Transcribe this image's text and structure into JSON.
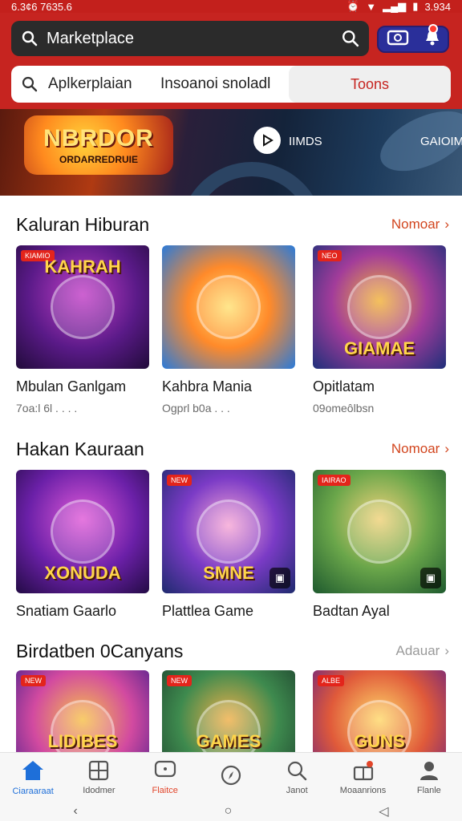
{
  "status": {
    "left": "6.3¢6 7635.6",
    "right": "3.934"
  },
  "search": {
    "label": "Marketplace"
  },
  "filters": {
    "first": "Aplkerplaian",
    "second": "Insoanoi snoladl",
    "segment": "Toons"
  },
  "banner": {
    "logo_line1": "NBRDOR",
    "logo_line2": "ORDARREDRUIE",
    "text1": "IIMDS",
    "text2": "GAIOIM"
  },
  "sections": [
    {
      "title": "Kaluran Hiburan",
      "link": "Nomoar",
      "cards": [
        {
          "title": "Mbulan Ganlgam",
          "sub": "7oa:l 6l . . . .",
          "tag": "KIAMIO",
          "caption": "KAHRAH"
        },
        {
          "title": "Kahbra Mania",
          "sub": "Ogprl b0a . . .",
          "tag": "",
          "caption": ""
        },
        {
          "title": "Opitlatam",
          "sub": "09omeôlbsn",
          "tag": "NEO",
          "caption": "GIAMAE"
        }
      ]
    },
    {
      "title": "Hakan Kauraan",
      "link": "Nomoar",
      "cards": [
        {
          "title": "Snatiam Gaarlo",
          "sub": "",
          "tag": "",
          "caption": "XONUDA"
        },
        {
          "title": "Plattlea Game",
          "sub": "",
          "tag": "NEW",
          "caption": "SMNE"
        },
        {
          "title": "Badtan Ayal",
          "sub": "",
          "tag": "IAIRAO",
          "caption": ""
        }
      ]
    },
    {
      "title": "Birdatben 0Canyans",
      "link": "Adauar",
      "cards": [
        {
          "title": "",
          "sub": "",
          "tag": "NEW",
          "caption": "LIDIBES"
        },
        {
          "title": "",
          "sub": "",
          "tag": "NEW",
          "caption": "GAMES"
        },
        {
          "title": "",
          "sub": "",
          "tag": "ALBE",
          "caption": "GUNS"
        }
      ]
    }
  ],
  "nav": [
    {
      "label": "Ciaraaraat",
      "icon": "home-icon"
    },
    {
      "label": "Idodmer",
      "icon": "grid-icon"
    },
    {
      "label": "Flaitce",
      "icon": "chat-icon"
    },
    {
      "label": "",
      "icon": "compass-icon"
    },
    {
      "label": "Janot",
      "icon": "search-icon"
    },
    {
      "label": "Moaanrions",
      "icon": "gift-icon"
    },
    {
      "label": "Flanle",
      "icon": "profile-icon"
    }
  ],
  "colors": {
    "header": "#c62420",
    "accent_link": "#d2451e",
    "nav_active": "#1e6fd9"
  }
}
